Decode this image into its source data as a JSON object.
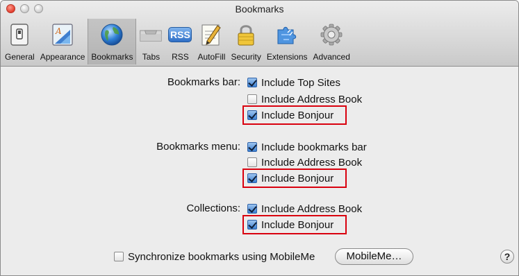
{
  "window": {
    "title": "Bookmarks"
  },
  "toolbar": {
    "items": [
      {
        "label": "General",
        "icon": "switch-icon",
        "selected": false
      },
      {
        "label": "Appearance",
        "icon": "appearance-icon",
        "selected": false
      },
      {
        "label": "Bookmarks",
        "icon": "globe-icon",
        "selected": true
      },
      {
        "label": "Tabs",
        "icon": "tabs-icon",
        "selected": false
      },
      {
        "label": "RSS",
        "icon": "rss-icon",
        "icon_text": "RSS",
        "selected": false
      },
      {
        "label": "AutoFill",
        "icon": "pencil-icon",
        "selected": false
      },
      {
        "label": "Security",
        "icon": "lock-icon",
        "selected": false
      },
      {
        "label": "Extensions",
        "icon": "puzzle-icon",
        "selected": false
      },
      {
        "label": "Advanced",
        "icon": "gear-icon",
        "selected": false
      }
    ]
  },
  "bookmarks_bar": {
    "label": "Bookmarks bar:",
    "options": [
      {
        "label": "Include Top Sites",
        "checked": true
      },
      {
        "label": "Include Address Book",
        "checked": false
      },
      {
        "label": "Include Bonjour",
        "checked": true
      }
    ]
  },
  "bookmarks_menu": {
    "label": "Bookmarks menu:",
    "options": [
      {
        "label": "Include bookmarks bar",
        "checked": true
      },
      {
        "label": "Include Address Book",
        "checked": false
      },
      {
        "label": "Include Bonjour",
        "checked": true
      }
    ]
  },
  "collections": {
    "label": "Collections:",
    "options": [
      {
        "label": "Include Address Book",
        "checked": true
      },
      {
        "label": "Include Bonjour",
        "checked": true
      }
    ]
  },
  "sync": {
    "label": "Synchronize bookmarks using MobileMe",
    "checked": false,
    "button_label": "MobileMe…"
  },
  "help": {
    "label": "?"
  },
  "colors": {
    "highlight": "#d9000e",
    "checkbox_checked": "#3b7fd0"
  }
}
